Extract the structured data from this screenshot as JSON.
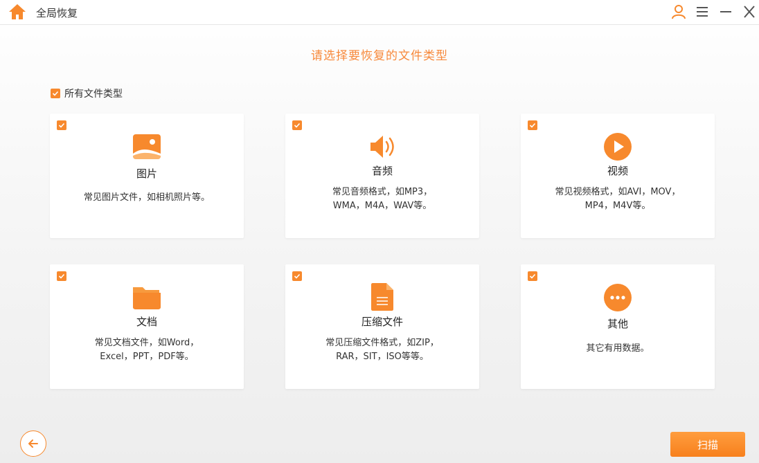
{
  "window": {
    "title": "全局恢复"
  },
  "heading": "请选择要恢复的文件类型",
  "all_types": {
    "label": "所有文件类型",
    "checked": true
  },
  "cards": [
    {
      "id": "pictures",
      "title": "图片",
      "desc": [
        "常见图片文件，如相机照片等。"
      ],
      "icon": "image-icon",
      "checked": true
    },
    {
      "id": "audio",
      "title": "音频",
      "desc": [
        "常见音频格式，如MP3，",
        "WMA，M4A，WAV等。"
      ],
      "icon": "speaker-icon",
      "checked": true
    },
    {
      "id": "video",
      "title": "视频",
      "desc": [
        "常见视频格式，如AVI，MOV，",
        "MP4，M4V等。"
      ],
      "icon": "play-icon",
      "checked": true
    },
    {
      "id": "documents",
      "title": "文档",
      "desc": [
        "常见文档文件，如Word，",
        "Excel，PPT，PDF等。"
      ],
      "icon": "folder-icon",
      "checked": true
    },
    {
      "id": "archives",
      "title": "压缩文件",
      "desc": [
        "常见压缩文件格式，如ZIP，",
        "RAR，SIT，ISO等等。"
      ],
      "icon": "file-icon",
      "checked": true
    },
    {
      "id": "other",
      "title": "其他",
      "desc": [
        "其它有用数据。"
      ],
      "icon": "more-icon",
      "checked": true
    }
  ],
  "buttons": {
    "scan": "扫描"
  },
  "colors": {
    "accent": "#f7892d",
    "heading": "#f7893b"
  }
}
